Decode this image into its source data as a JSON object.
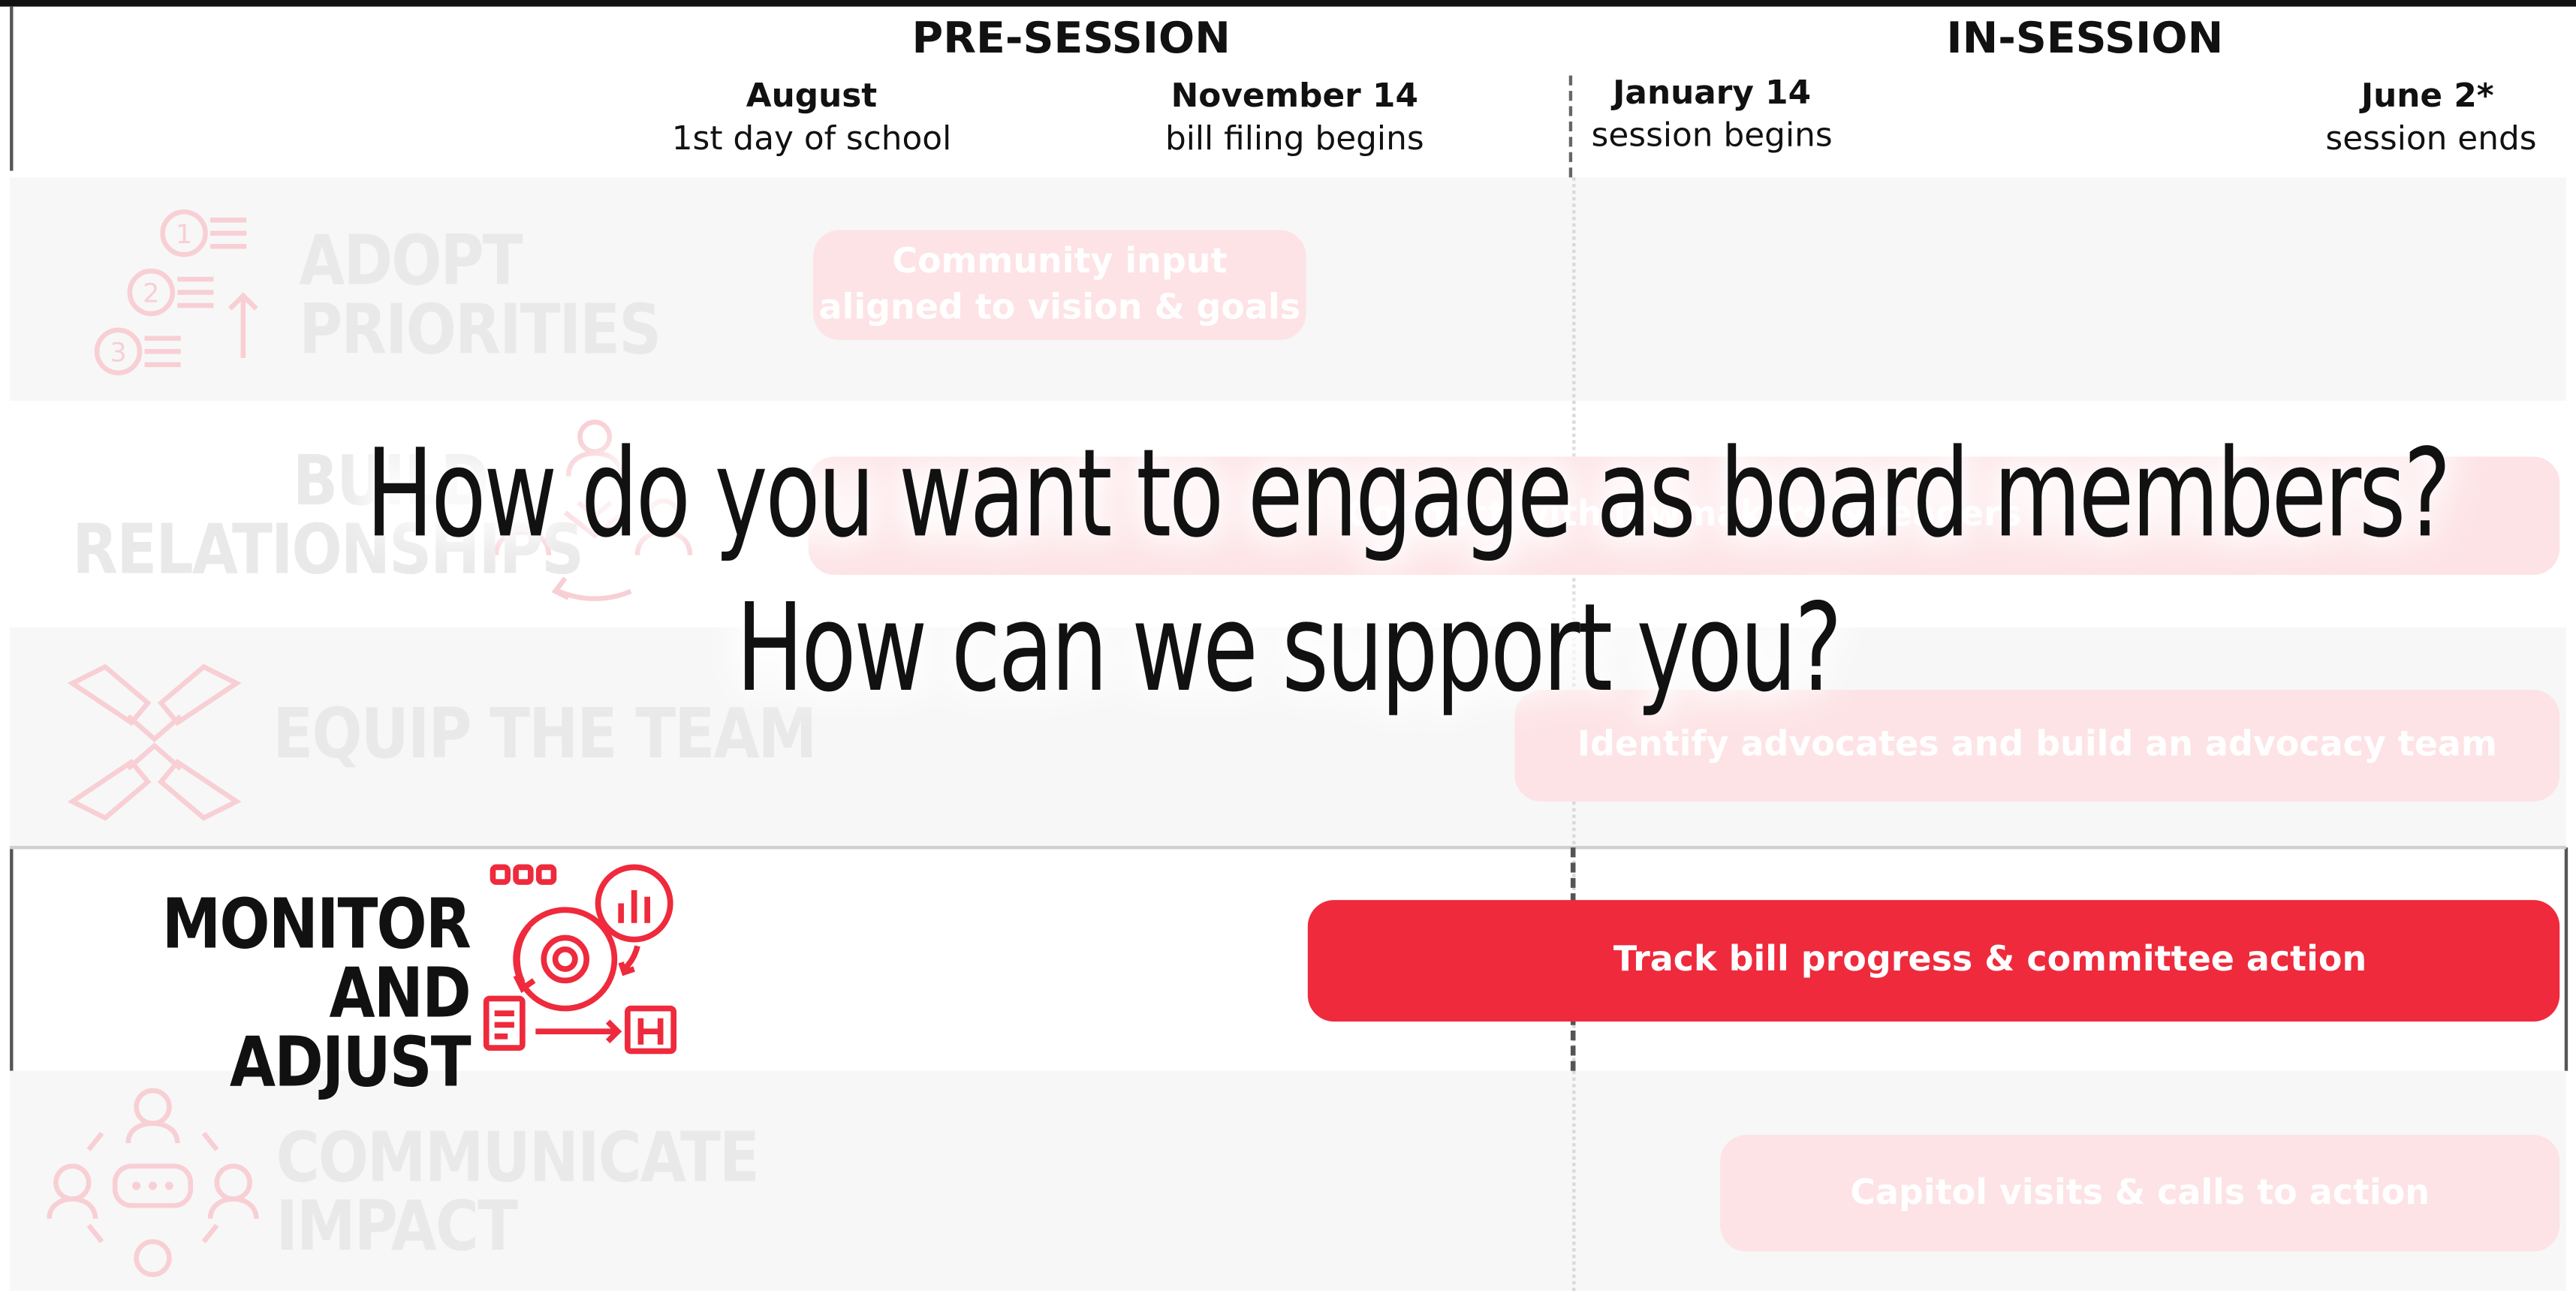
{
  "phases": {
    "pre_session": "PRE-SESSION",
    "in_session": "IN-SESSION"
  },
  "dates": [
    {
      "date": "August",
      "sub": "1st day of school"
    },
    {
      "date": "November 14",
      "sub": "bill filing begins"
    },
    {
      "date": "January 14",
      "sub": "session begins"
    },
    {
      "date": "June 2*",
      "sub": "session ends"
    }
  ],
  "rows": [
    {
      "label_line1": "ADOPT",
      "label_line2": "PRIORITIES",
      "icon": "numbered-list-icon",
      "bar": "Community input\naligned to vision & goals",
      "state": "faded"
    },
    {
      "label_line1": "BUILD",
      "label_line2": "RELATIONSHIPS",
      "icon": "people-network-icon",
      "bar": "Connect with lawmakers & leaders",
      "state": "faded"
    },
    {
      "label_line1": "EQUIP THE TEAM",
      "label_line2": "",
      "icon": "handshake-icon",
      "bar": "Identify advocates and build an advocacy team",
      "state": "faded"
    },
    {
      "label_line1": "MONITOR AND",
      "label_line2": "ADJUST",
      "icon": "monitor-cycle-icon",
      "bar": "Track bill progress & committee action",
      "state": "active"
    },
    {
      "label_line1": "COMMUNICATE",
      "label_line2": "IMPACT",
      "icon": "community-chat-icon",
      "bar": "Capitol visits & calls to action",
      "state": "faded"
    }
  ],
  "overlay": {
    "line1": "How do you want to engage as board members?",
    "line2": "How can we support you?"
  },
  "colors": {
    "accent_red": "#ee2a3c",
    "faded_red": "#fde3e6",
    "shade_gray": "#f7f7f7",
    "text_dark": "#111111"
  }
}
